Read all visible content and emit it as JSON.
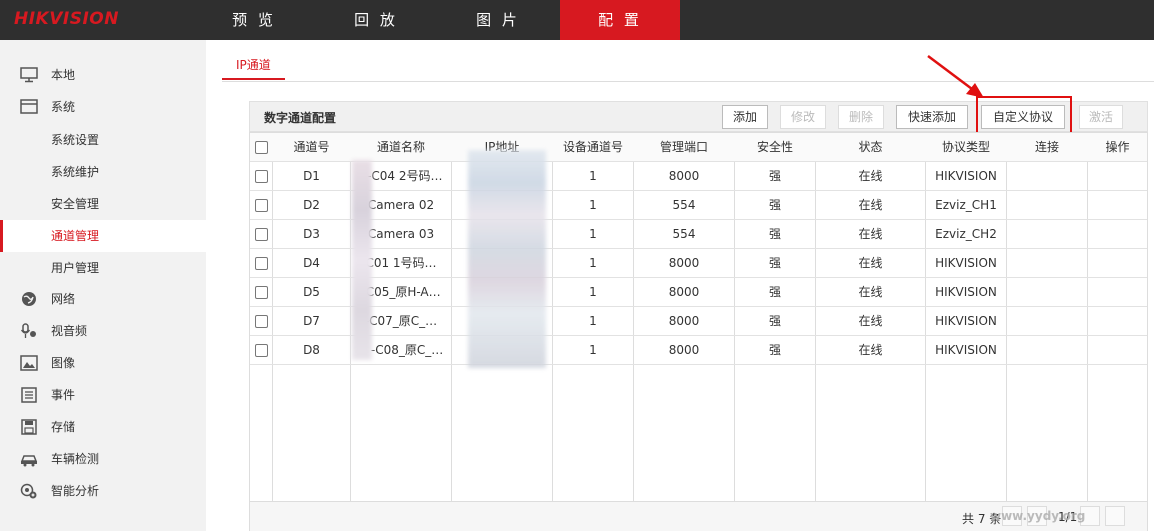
{
  "app": {
    "logo": "HIKVISION"
  },
  "top_nav": [
    {
      "label": "预 览"
    },
    {
      "label": "回 放"
    },
    {
      "label": "图 片"
    },
    {
      "label": "配 置"
    }
  ],
  "sidebar": {
    "items": [
      {
        "label": "本地",
        "icon": "monitor-icon"
      },
      {
        "label": "系统",
        "icon": "system-icon"
      },
      {
        "label": "系统设置"
      },
      {
        "label": "系统维护"
      },
      {
        "label": "安全管理"
      },
      {
        "label": "通道管理"
      },
      {
        "label": "用户管理"
      },
      {
        "label": "网络",
        "icon": "globe-icon"
      },
      {
        "label": "视音频",
        "icon": "mic-camera-icon"
      },
      {
        "label": "图像",
        "icon": "image-icon"
      },
      {
        "label": "事件",
        "icon": "list-icon"
      },
      {
        "label": "存储",
        "icon": "disk-icon"
      },
      {
        "label": "车辆检测",
        "icon": "car-icon"
      },
      {
        "label": "智能分析",
        "icon": "smart-icon"
      }
    ]
  },
  "subtab": {
    "label": "IP通道"
  },
  "panel": {
    "title": "数字通道配置",
    "buttons": {
      "add": "添加",
      "modify": "修改",
      "delete": "删除",
      "quick_add": "快速添加",
      "custom_protocol": "自定义协议",
      "activate": "激活"
    }
  },
  "table": {
    "columns": [
      "通道号",
      "通道名称",
      "IP地址",
      "设备通道号",
      "管理端口",
      "安全性",
      "状态",
      "协议类型",
      "连接",
      "操作"
    ],
    "rows": [
      {
        "ch": "D1",
        "name": "7-C04 2号码…",
        "ip": "",
        "dev_ch": "1",
        "port": "8000",
        "sec": "强",
        "status": "在线",
        "proto": "HIKVISION"
      },
      {
        "ch": "D2",
        "name": "Camera 02",
        "ip": "",
        "dev_ch": "1",
        "port": "554",
        "sec": "强",
        "status": "在线",
        "proto": "Ezviz_CH1"
      },
      {
        "ch": "D3",
        "name": "Camera 03",
        "ip": "",
        "dev_ch": "1",
        "port": "554",
        "sec": "强",
        "status": "在线",
        "proto": "Ezviz_CH2"
      },
      {
        "ch": "D4",
        "name": "C01 1号码…",
        "ip": "",
        "dev_ch": "1",
        "port": "8000",
        "sec": "强",
        "status": "在线",
        "proto": "HIKVISION"
      },
      {
        "ch": "D5",
        "name": "-C05_原H-A…",
        "ip": "",
        "dev_ch": "1",
        "port": "8000",
        "sec": "强",
        "status": "在线",
        "proto": "HIKVISION"
      },
      {
        "ch": "D7",
        "name": "-C07_原C_…",
        "ip": "",
        "dev_ch": "1",
        "port": "8000",
        "sec": "强",
        "status": "在线",
        "proto": "HIKVISION"
      },
      {
        "ch": "D8",
        "name": "C -C08_原C_…",
        "ip": "",
        "dev_ch": "1",
        "port": "8000",
        "sec": "强",
        "status": "在线",
        "proto": "HIKVISION"
      }
    ]
  },
  "footer": {
    "total": "共 7 条",
    "page": "1/1"
  },
  "watermark": "www.yydy.org",
  "colors": {
    "accent": "#d71920",
    "topbar": "#2f2f2f",
    "sidebar": "#f2f2f2",
    "annotation": "#e01010"
  }
}
